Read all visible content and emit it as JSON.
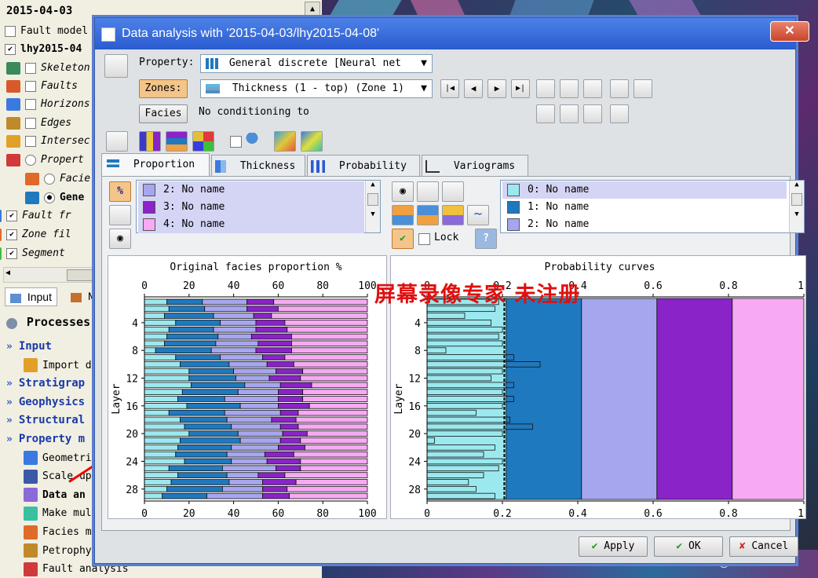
{
  "left_panel": {
    "top_title": "2015-04-03",
    "tree": [
      {
        "label": "Fault model",
        "checked": false
      },
      {
        "label": "lhy2015-04",
        "checked": true,
        "bold": true
      },
      {
        "label": "Skeleton",
        "checked": false
      },
      {
        "label": "Faults",
        "checked": false
      },
      {
        "label": "Horizons",
        "checked": false
      },
      {
        "label": "Edges",
        "checked": false
      },
      {
        "label": "Intersec",
        "checked": false
      },
      {
        "label": "Propert",
        "radio": true
      },
      {
        "label": "Facie",
        "radio": true
      },
      {
        "label": "Gene",
        "radio": true,
        "selected": true
      },
      {
        "label": "Fault fr",
        "checked": true
      },
      {
        "label": "Zone fil",
        "checked": true
      },
      {
        "label": "Segment",
        "checked": true
      }
    ],
    "bottom_tabs": [
      "Input",
      "M"
    ],
    "processes_label": "Processes",
    "processes": [
      {
        "label": "Input",
        "header": true
      },
      {
        "label": "Import d",
        "header": false
      },
      {
        "label": "Stratigrap",
        "header": true
      },
      {
        "label": "Geophysics",
        "header": true
      },
      {
        "label": "Structural",
        "header": true
      },
      {
        "label": "Property m",
        "header": true
      },
      {
        "label": "Geometri",
        "header": false
      },
      {
        "label": "Scale up",
        "header": false
      },
      {
        "label": "Data an",
        "header": false,
        "bold": true
      },
      {
        "label": "Make mul",
        "header": false
      },
      {
        "label": "Facies m",
        "header": false
      },
      {
        "label": "Petrophy",
        "header": false
      },
      {
        "label": "Fault analysis",
        "header": false
      }
    ]
  },
  "dialog": {
    "title": "Data analysis with '2015-04-03/lhy2015-04-08'",
    "property_label": "Property:",
    "property_value": "General discrete [Neural net",
    "zones_label": "Zones:",
    "zones_value": "Thickness (1 - top) (Zone 1)",
    "facies_label": "Facies",
    "conditioning_text": "No conditioning to",
    "tabs": [
      "Proportion",
      "Thickness",
      "Probability",
      "Variograms"
    ],
    "left_list": [
      "2: No name",
      "3: No name",
      "4: No name"
    ],
    "right_list": [
      "0: No name",
      "1: No name",
      "2: No name"
    ],
    "lock_label": "Lock",
    "help_label": "?",
    "buttons": {
      "apply": "Apply",
      "ok": "OK",
      "cancel": "Cancel"
    },
    "watermark": "屏幕录像专家 未注册"
  },
  "colors": {
    "facies0": "#9be9ef",
    "facies1": "#1f79be",
    "facies2": "#a6a6ef",
    "facies3": "#8a23c8",
    "facies4": "#f7a9f3",
    "title_bar": "#2a5bd0"
  },
  "credit": "CSDN @xiaokcehui",
  "chart_data": [
    {
      "type": "bar",
      "stacked": "horizontal",
      "title": "Original facies proportion %",
      "ylabel": "Layer",
      "xlim": [
        0,
        100
      ],
      "x_ticks": [
        0,
        20,
        40,
        60,
        80,
        100
      ],
      "y_ticks": [
        4,
        8,
        12,
        16,
        20,
        24,
        28
      ],
      "layers": [
        1,
        2,
        3,
        4,
        5,
        6,
        7,
        8,
        9,
        10,
        11,
        12,
        13,
        14,
        15,
        16,
        17,
        18,
        19,
        20,
        21,
        22,
        23,
        24,
        25,
        26,
        27,
        28,
        29
      ],
      "series": [
        {
          "key": "facies0",
          "values": [
            10,
            11,
            9,
            14,
            11,
            10,
            9,
            5,
            14,
            16,
            20,
            20,
            21,
            17,
            15,
            19,
            11,
            16,
            18,
            20,
            16,
            15,
            14,
            18,
            11,
            15,
            12,
            10,
            8
          ]
        },
        {
          "key": "facies1",
          "values": [
            16,
            16,
            22,
            20,
            20,
            23,
            23,
            25,
            20,
            22,
            20,
            21,
            24,
            25,
            21,
            24,
            25,
            21,
            21,
            22,
            27,
            24,
            23,
            21,
            24,
            22,
            26,
            25,
            20
          ]
        },
        {
          "key": "facies2",
          "values": [
            20,
            19,
            18,
            16,
            19,
            15,
            19,
            20,
            19,
            17,
            19,
            15,
            16,
            18,
            24,
            17,
            25,
            20,
            22,
            20,
            18,
            21,
            17,
            16,
            24,
            14,
            15,
            18,
            25
          ]
        },
        {
          "key": "facies3",
          "values": [
            12,
            14,
            8,
            13,
            14,
            18,
            15,
            16,
            10,
            12,
            12,
            14,
            14,
            11,
            11,
            14,
            8,
            11,
            8,
            11,
            9,
            12,
            13,
            15,
            11,
            12,
            15,
            11,
            12
          ]
        },
        {
          "key": "facies4",
          "values": [
            42,
            40,
            43,
            37,
            36,
            34,
            34,
            34,
            37,
            33,
            29,
            30,
            25,
            29,
            29,
            26,
            31,
            32,
            31,
            27,
            30,
            28,
            33,
            30,
            30,
            37,
            32,
            36,
            35
          ]
        }
      ]
    },
    {
      "type": "bar",
      "title": "Probability curves",
      "ylabel": "Layer",
      "xlim": [
        0,
        1
      ],
      "x_ticks": [
        0,
        0.2,
        0.4,
        0.6,
        0.8,
        1
      ],
      "y_ticks": [
        4,
        8,
        12,
        16,
        20,
        24,
        28
      ],
      "bands": [
        {
          "key": "facies0",
          "from": 0,
          "to": 0.21
        },
        {
          "key": "facies1",
          "from": 0.21,
          "to": 0.41
        },
        {
          "key": "facies2",
          "from": 0.41,
          "to": 0.61
        },
        {
          "key": "facies3",
          "from": 0.61,
          "to": 0.81
        },
        {
          "key": "facies4",
          "from": 0.81,
          "to": 1
        }
      ],
      "layer_values": [
        0.19,
        0.18,
        0.1,
        0.17,
        0.2,
        0.19,
        0.2,
        0.05,
        0.23,
        0.3,
        0.2,
        0.17,
        0.23,
        0.2,
        0.23,
        0.2,
        0.13,
        0.22,
        0.28,
        0.2,
        0.02,
        0.18,
        0.15,
        0.2,
        0.19,
        0.15,
        0.11,
        0.13,
        0.18
      ]
    }
  ]
}
